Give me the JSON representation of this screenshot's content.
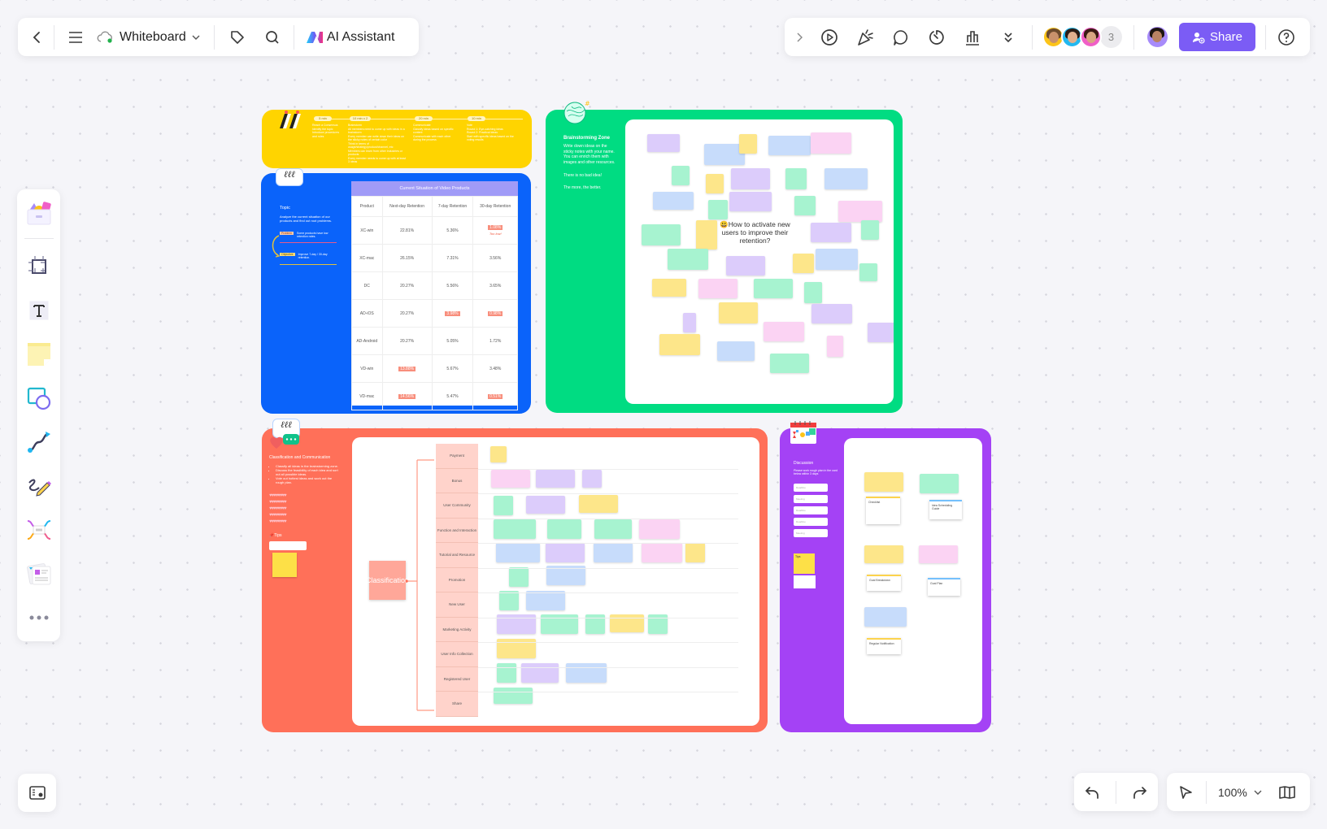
{
  "topbar": {
    "back_label": "Back",
    "menu_label": "Menu",
    "title": "Whiteboard",
    "sync_status": "saved",
    "tag_label": "Tags",
    "search_label": "Search",
    "ai_label": "AI Assistant"
  },
  "toolbar_right": {
    "expand_label": "Expand",
    "present_label": "Present",
    "celebrate_label": "Celebrate",
    "comment_label": "Comments",
    "timer_label": "Timer",
    "vote_label": "Vote",
    "more_label": "More",
    "collaborators_extra_count": "3",
    "share_label": "Share",
    "help_label": "Help",
    "accent_color": "#7b5cf5"
  },
  "left_tools": [
    {
      "name": "templates",
      "label": "Templates"
    },
    {
      "name": "frame",
      "label": "Frame"
    },
    {
      "name": "text",
      "label": "Text"
    },
    {
      "name": "sticky-note",
      "label": "Sticky note"
    },
    {
      "name": "shapes",
      "label": "Shapes"
    },
    {
      "name": "connector",
      "label": "Connector"
    },
    {
      "name": "pen",
      "label": "Pen"
    },
    {
      "name": "mindmap",
      "label": "Mind map"
    },
    {
      "name": "cards",
      "label": "Cards"
    },
    {
      "name": "more",
      "label": "More"
    }
  ],
  "bottom": {
    "minimap_label": "Minimap",
    "undo_label": "Undo",
    "redo_label": "Redo",
    "select_label": "Select",
    "zoom_level": "100%",
    "map_label": "Map view"
  },
  "frames": {
    "agenda": {
      "color": "#ffd400",
      "steps": [
        {
          "time": "5 min",
          "title": "Reach a Consensus",
          "items": [
            "Identify the topic",
            "Introduce procedures and rules"
          ]
        },
        {
          "time": "10 min x 2",
          "title": "Brainstorm",
          "items": [
            "All members need to come up with ideas in a brainstorm",
            "Every member can write down their ideas on the sticky notes of certain color",
            "Think in terms of usage/strategy/product/channel, etc",
            "Members can learn from other industries or products",
            "Every member needs to come up with at least 3 ideas"
          ]
        },
        {
          "time": "20 min",
          "title": "Communicate",
          "items": [
            "Classify ideas based on specific content",
            "Communicate with each other during the process"
          ]
        },
        {
          "time": "10 min",
          "title": "Vote",
          "items": [
            "Round 1: Eye-catching ideas",
            "Round 2: Practical ideas",
            "Start with specific ideas based on the voting results"
          ]
        }
      ]
    },
    "topic": {
      "color": "#0a63fa",
      "heading": "Topic",
      "description": "Analyze the current situation of our products and find out root problems.",
      "problem_tag": "Problem",
      "problem_text": "Some products have low retention rates.",
      "objective_tag": "Objective",
      "objective_text": "Improve 7-day / 30-day retention.",
      "table": {
        "title": "Current Situation of Video Products",
        "headers": [
          "Product",
          "Next-day Retention",
          "7-day Retention",
          "30-day Retention"
        ],
        "rows": [
          [
            "XC-win",
            "22.81%",
            "5.36%",
            "1.08%"
          ],
          [
            "XC-mac",
            "26.15%",
            "7.31%",
            "3.56%"
          ],
          [
            "DC",
            "20.27%",
            "5.56%",
            "3.65%"
          ],
          [
            "AD-iOS",
            "20.27%",
            "3.98%",
            "0.98%"
          ],
          [
            "AD-Android",
            "20.27%",
            "5.05%",
            "1.72%"
          ],
          [
            "VD-win",
            "13.88%",
            "5.67%",
            "3.48%"
          ],
          [
            "VD-mac",
            "14.56%",
            "5.47%",
            "0.51%"
          ]
        ],
        "highlighted": [
          [
            0,
            3
          ],
          [
            3,
            2
          ],
          [
            3,
            3
          ],
          [
            5,
            1
          ],
          [
            6,
            1
          ],
          [
            6,
            3
          ]
        ],
        "annotation": "Too low!"
      }
    },
    "brainstorm": {
      "color": "#00dc82",
      "heading": "Brainstorming Zone",
      "description": "Write down ideas on the sticky notes with your name. You can enrich them with images and other resources.",
      "line1": "There is no bad idea!",
      "line2": "The more, the better.",
      "question": "How to activate new users to improve their retention?",
      "question_emoji": "😃"
    },
    "classification": {
      "color": "#ff7059",
      "heading": "Classification and Communication",
      "bullets": [
        "Classify all ideas in the brainstorming zone.",
        "Discuss the feasibility of each idea and sort out all possible ideas.",
        "Vote out hottest ideas and work out the rough plan."
      ],
      "tips_label": "Tips",
      "root_label": "Classification",
      "categories": [
        "Payment",
        "Bonus",
        "User Community",
        "Function and Interaction",
        "Tutorial and Resource",
        "Promotion",
        "New User",
        "Marketing Activity",
        "User Info Collection",
        "Registered User",
        "Share"
      ]
    },
    "discussion": {
      "color": "#a442f5",
      "heading": "Discussion",
      "description": "Please work rough plan in the card below within 3 days",
      "fields": [
        "Deadline",
        "Meeting",
        "Deadline",
        "Deadline",
        "Meeting"
      ],
      "tips_label": "Tips",
      "cards": [
        "Checklist",
        "Idea Scheduling Guide",
        "Goal Breakdown",
        "Goal Plan",
        "Regular Notification"
      ]
    }
  }
}
